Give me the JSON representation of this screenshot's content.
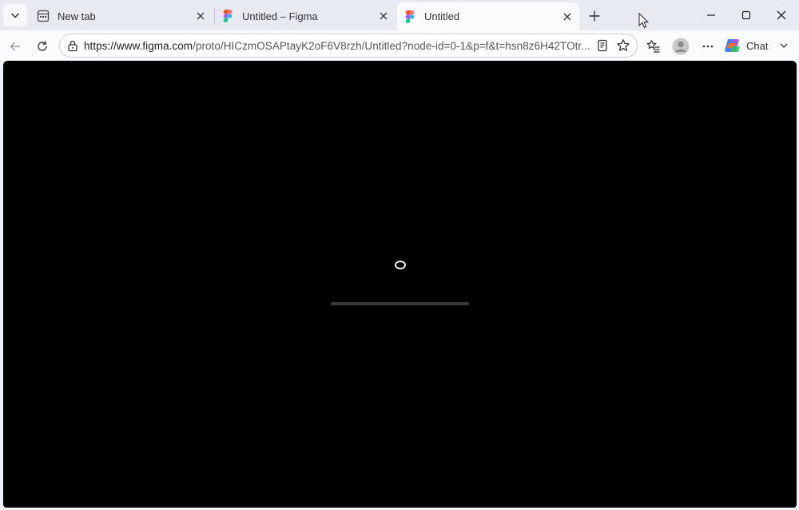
{
  "tabs": [
    {
      "label": "New tab",
      "favicon": "newtab-icon",
      "active": false
    },
    {
      "label": "Untitled – Figma",
      "favicon": "figma-icon",
      "active": false
    },
    {
      "label": "Untitled",
      "favicon": "figma-icon",
      "active": true
    }
  ],
  "address": {
    "host": "https://www.figma.com",
    "path": "/proto/HICzmOSAPtayK2oF6V8rzh/Untitled?node-id=0-1&p=f&t=hsn8z6H42TOtr..."
  },
  "toolbar": {
    "chat_label": "Chat"
  },
  "loader": {
    "progress": 0.0
  },
  "colors": {
    "viewport_bg": "#000000",
    "figma_red": "#F24E1E",
    "figma_orange": "#FF7262",
    "figma_purple": "#A259FF",
    "figma_blue": "#1ABCFE",
    "figma_green": "#0ACF83"
  }
}
